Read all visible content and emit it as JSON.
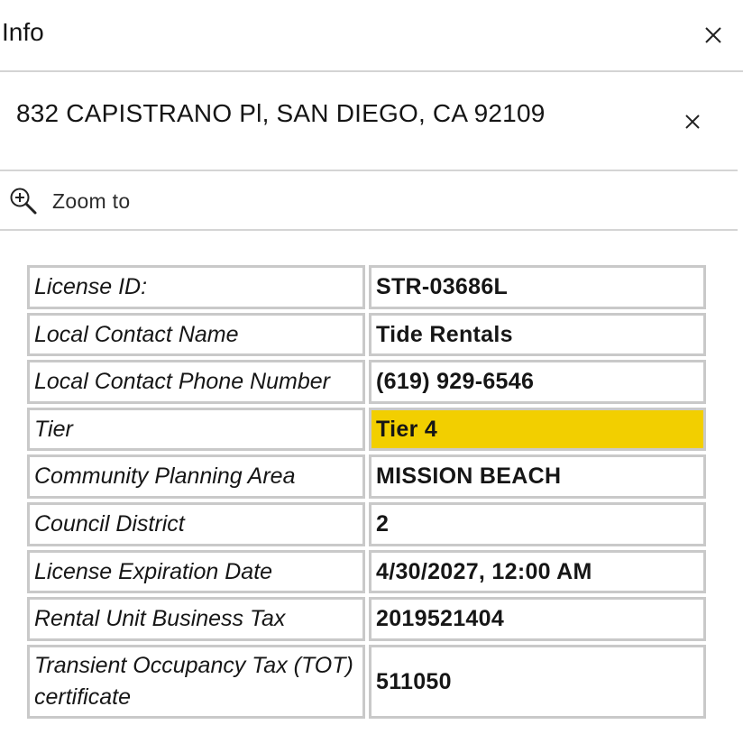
{
  "header": {
    "title": "Info",
    "close_icon": "close-icon"
  },
  "feature": {
    "title": "832 CAPISTRANO Pl, SAN DIEGO, CA 92109",
    "close_icon": "close-icon"
  },
  "actions": {
    "zoom_label": "Zoom to",
    "zoom_icon": "zoom-in-icon"
  },
  "attributes": [
    {
      "label": "License ID:",
      "value": "STR-03686L"
    },
    {
      "label": "Local Contact Name",
      "value": "Tide Rentals"
    },
    {
      "label": "Local Contact Phone Number",
      "value": "(619) 929-6546"
    },
    {
      "label": "Tier",
      "value": "Tier 4",
      "highlight": true
    },
    {
      "label": "Community Planning Area",
      "value": "MISSION BEACH"
    },
    {
      "label": "Council District",
      "value": "2"
    },
    {
      "label": "License Expiration Date",
      "value": "4/30/2027, 12:00 AM"
    },
    {
      "label": "Rental Unit Business Tax",
      "value": "2019521404"
    },
    {
      "label": "Transient Occupancy Tax (TOT) certificate",
      "value": "511050"
    }
  ],
  "colors": {
    "highlight": "#f2cf00",
    "border": "#c9c9c9",
    "divider": "#d4d4d4"
  }
}
